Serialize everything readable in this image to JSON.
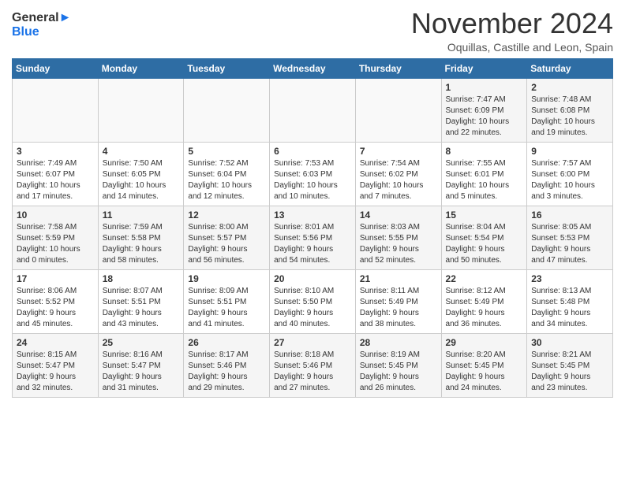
{
  "header": {
    "logo_line1": "General",
    "logo_line2": "Blue",
    "month": "November 2024",
    "location": "Oquillas, Castille and Leon, Spain"
  },
  "days_of_week": [
    "Sunday",
    "Monday",
    "Tuesday",
    "Wednesday",
    "Thursday",
    "Friday",
    "Saturday"
  ],
  "weeks": [
    [
      {
        "day": "",
        "info": ""
      },
      {
        "day": "",
        "info": ""
      },
      {
        "day": "",
        "info": ""
      },
      {
        "day": "",
        "info": ""
      },
      {
        "day": "",
        "info": ""
      },
      {
        "day": "1",
        "info": "Sunrise: 7:47 AM\nSunset: 6:09 PM\nDaylight: 10 hours\nand 22 minutes."
      },
      {
        "day": "2",
        "info": "Sunrise: 7:48 AM\nSunset: 6:08 PM\nDaylight: 10 hours\nand 19 minutes."
      }
    ],
    [
      {
        "day": "3",
        "info": "Sunrise: 7:49 AM\nSunset: 6:07 PM\nDaylight: 10 hours\nand 17 minutes."
      },
      {
        "day": "4",
        "info": "Sunrise: 7:50 AM\nSunset: 6:05 PM\nDaylight: 10 hours\nand 14 minutes."
      },
      {
        "day": "5",
        "info": "Sunrise: 7:52 AM\nSunset: 6:04 PM\nDaylight: 10 hours\nand 12 minutes."
      },
      {
        "day": "6",
        "info": "Sunrise: 7:53 AM\nSunset: 6:03 PM\nDaylight: 10 hours\nand 10 minutes."
      },
      {
        "day": "7",
        "info": "Sunrise: 7:54 AM\nSunset: 6:02 PM\nDaylight: 10 hours\nand 7 minutes."
      },
      {
        "day": "8",
        "info": "Sunrise: 7:55 AM\nSunset: 6:01 PM\nDaylight: 10 hours\nand 5 minutes."
      },
      {
        "day": "9",
        "info": "Sunrise: 7:57 AM\nSunset: 6:00 PM\nDaylight: 10 hours\nand 3 minutes."
      }
    ],
    [
      {
        "day": "10",
        "info": "Sunrise: 7:58 AM\nSunset: 5:59 PM\nDaylight: 10 hours\nand 0 minutes."
      },
      {
        "day": "11",
        "info": "Sunrise: 7:59 AM\nSunset: 5:58 PM\nDaylight: 9 hours\nand 58 minutes."
      },
      {
        "day": "12",
        "info": "Sunrise: 8:00 AM\nSunset: 5:57 PM\nDaylight: 9 hours\nand 56 minutes."
      },
      {
        "day": "13",
        "info": "Sunrise: 8:01 AM\nSunset: 5:56 PM\nDaylight: 9 hours\nand 54 minutes."
      },
      {
        "day": "14",
        "info": "Sunrise: 8:03 AM\nSunset: 5:55 PM\nDaylight: 9 hours\nand 52 minutes."
      },
      {
        "day": "15",
        "info": "Sunrise: 8:04 AM\nSunset: 5:54 PM\nDaylight: 9 hours\nand 50 minutes."
      },
      {
        "day": "16",
        "info": "Sunrise: 8:05 AM\nSunset: 5:53 PM\nDaylight: 9 hours\nand 47 minutes."
      }
    ],
    [
      {
        "day": "17",
        "info": "Sunrise: 8:06 AM\nSunset: 5:52 PM\nDaylight: 9 hours\nand 45 minutes."
      },
      {
        "day": "18",
        "info": "Sunrise: 8:07 AM\nSunset: 5:51 PM\nDaylight: 9 hours\nand 43 minutes."
      },
      {
        "day": "19",
        "info": "Sunrise: 8:09 AM\nSunset: 5:51 PM\nDaylight: 9 hours\nand 41 minutes."
      },
      {
        "day": "20",
        "info": "Sunrise: 8:10 AM\nSunset: 5:50 PM\nDaylight: 9 hours\nand 40 minutes."
      },
      {
        "day": "21",
        "info": "Sunrise: 8:11 AM\nSunset: 5:49 PM\nDaylight: 9 hours\nand 38 minutes."
      },
      {
        "day": "22",
        "info": "Sunrise: 8:12 AM\nSunset: 5:49 PM\nDaylight: 9 hours\nand 36 minutes."
      },
      {
        "day": "23",
        "info": "Sunrise: 8:13 AM\nSunset: 5:48 PM\nDaylight: 9 hours\nand 34 minutes."
      }
    ],
    [
      {
        "day": "24",
        "info": "Sunrise: 8:15 AM\nSunset: 5:47 PM\nDaylight: 9 hours\nand 32 minutes."
      },
      {
        "day": "25",
        "info": "Sunrise: 8:16 AM\nSunset: 5:47 PM\nDaylight: 9 hours\nand 31 minutes."
      },
      {
        "day": "26",
        "info": "Sunrise: 8:17 AM\nSunset: 5:46 PM\nDaylight: 9 hours\nand 29 minutes."
      },
      {
        "day": "27",
        "info": "Sunrise: 8:18 AM\nSunset: 5:46 PM\nDaylight: 9 hours\nand 27 minutes."
      },
      {
        "day": "28",
        "info": "Sunrise: 8:19 AM\nSunset: 5:45 PM\nDaylight: 9 hours\nand 26 minutes."
      },
      {
        "day": "29",
        "info": "Sunrise: 8:20 AM\nSunset: 5:45 PM\nDaylight: 9 hours\nand 24 minutes."
      },
      {
        "day": "30",
        "info": "Sunrise: 8:21 AM\nSunset: 5:45 PM\nDaylight: 9 hours\nand 23 minutes."
      }
    ]
  ]
}
